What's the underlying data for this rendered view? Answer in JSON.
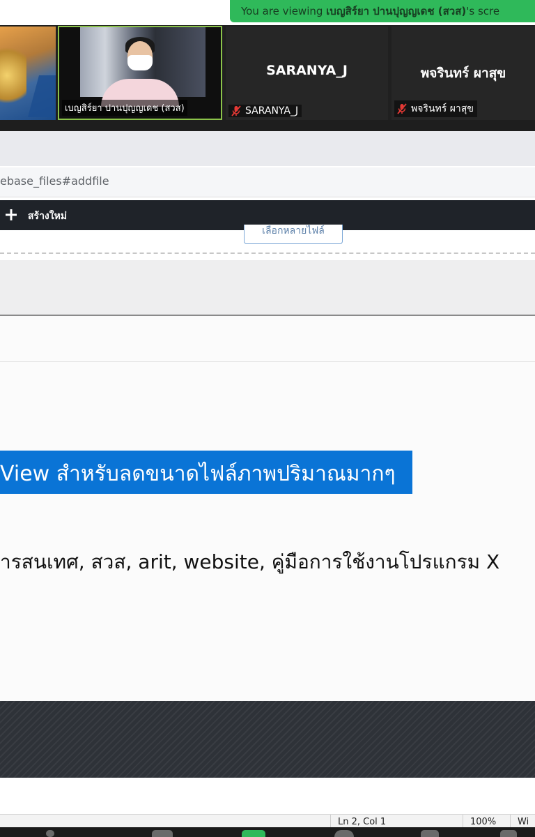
{
  "zoom": {
    "banner_prefix": "You are viewing",
    "banner_name": "เบญสิร์ยา ปานปุญญเดช (สวส)",
    "banner_suffix": "'s scre",
    "participants": [
      {
        "display": "",
        "label": "เบญสิร์ยา ปานปุญญเดช (สวส)",
        "muted": false
      },
      {
        "display": "SARANYA_J",
        "label": "SARANYA_J",
        "muted": true
      },
      {
        "display": "พจรินทร์ ผาสุข",
        "label": "พจรินทร์ ผาสุข",
        "muted": true
      }
    ],
    "accent_green": "#2fb95a",
    "muted_color": "#e53935"
  },
  "browser": {
    "url": "ebase_files#addfile",
    "nav_create": "สร้างใหม่",
    "select_files_button": "เลือกหลายไฟล์"
  },
  "document": {
    "title": "View สำหรับลดขนาดไฟล์ภาพปริมาณมากๆ",
    "tags": "ารสนเทศ, สวส, arit, website, คู่มือการใช้งานโปรแกรม X",
    "selection_color": "#0a74d6"
  },
  "statusbar": {
    "position": "Ln 2, Col 1",
    "zoom": "100%",
    "eol": "Wi"
  }
}
